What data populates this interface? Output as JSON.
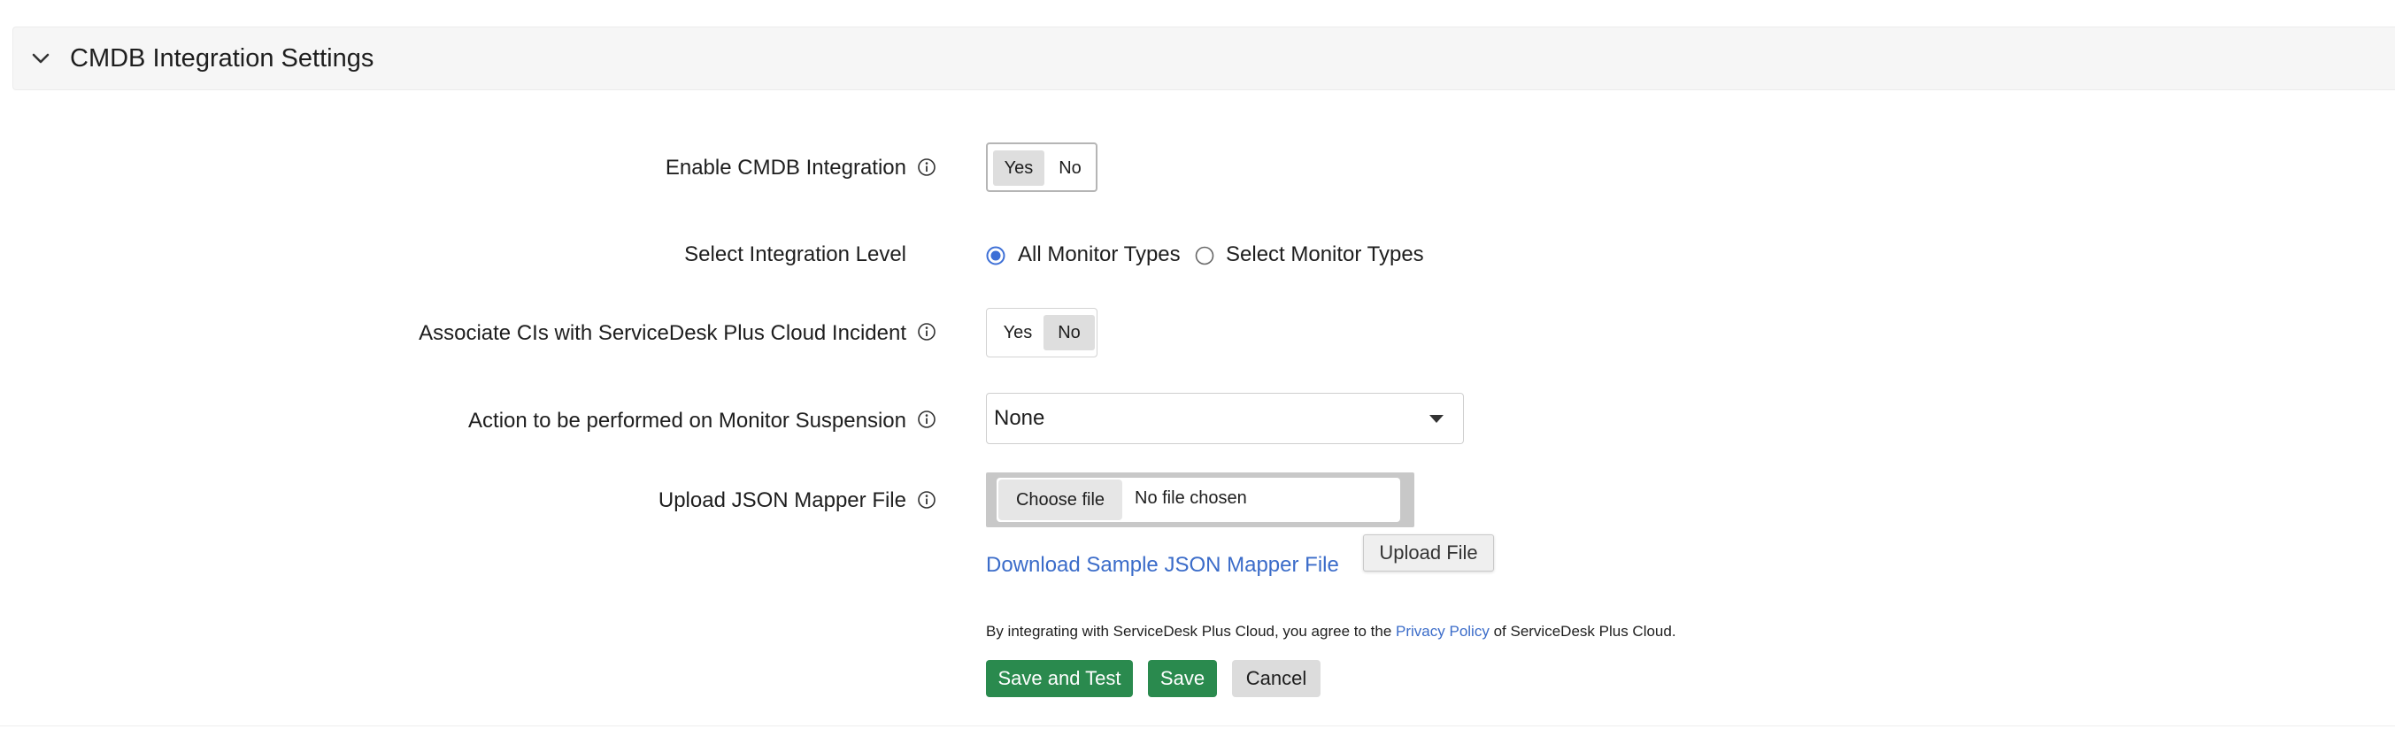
{
  "section": {
    "title": "CMDB Integration Settings"
  },
  "fields": {
    "enable_cmdb": {
      "label": "Enable CMDB Integration",
      "options": [
        "Yes",
        "No"
      ],
      "selected": "Yes"
    },
    "integration_level": {
      "label": "Select Integration Level",
      "options": [
        "All Monitor Types",
        "Select Monitor Types"
      ],
      "selected": "All Monitor Types"
    },
    "associate_cis": {
      "label": "Associate CIs with ServiceDesk Plus Cloud Incident",
      "options": [
        "Yes",
        "No"
      ],
      "selected": "No"
    },
    "suspension_action": {
      "label": "Action to be performed on Monitor Suspension",
      "value": "None"
    },
    "json_mapper": {
      "label": "Upload JSON Mapper File",
      "choose_label": "Choose file",
      "status": "No file chosen",
      "upload_label": "Upload File",
      "download_link": "Download Sample JSON Mapper File"
    }
  },
  "consent": {
    "prefix": "By integrating with ServiceDesk Plus Cloud, you agree to the",
    "link": "Privacy Policy",
    "suffix": "of ServiceDesk Plus Cloud."
  },
  "actions": {
    "save_and_test": "Save and Test",
    "save": "Save",
    "cancel": "Cancel"
  },
  "colors": {
    "primary_green": "#2a8a4e",
    "link_blue": "#3b6cc9",
    "radio_blue": "#3d6fd6"
  },
  "icons": {
    "collapse": "chevron-down-icon",
    "info": "info-icon",
    "dropdown": "caret-down-icon"
  }
}
